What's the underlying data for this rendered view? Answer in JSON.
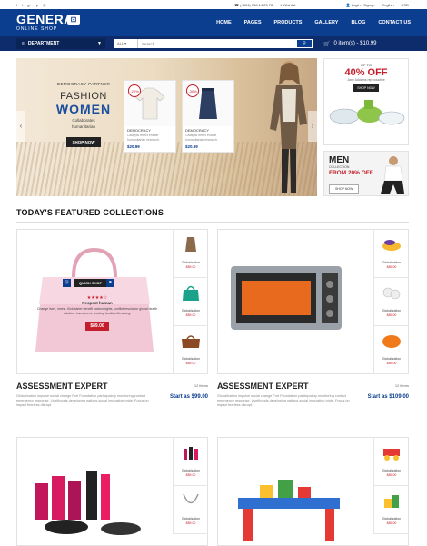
{
  "topbar": {
    "phone": "(+804) 358 14 25 78",
    "wishlist": "Wishlist",
    "account": "Login / Signup",
    "language": "English",
    "currency": "USD"
  },
  "logo": {
    "name": "GENERA",
    "sub": "ONLINE SHOP"
  },
  "nav": [
    "HOME",
    "PAGES",
    "PRODUCTS",
    "GALLERY",
    "BLOG",
    "CONTACT US"
  ],
  "department": "DEPARTMENT",
  "search": {
    "category": "ALL",
    "placeholder": "Search..."
  },
  "cart": {
    "label": "0 item(s) - $10.99"
  },
  "hero": {
    "kicker": "DEMOCRACY PARTNER",
    "line1": "FASHION",
    "line2": "WOMEN",
    "desc1": "Collaborates",
    "desc2": "humanitarian",
    "shop": "SHOP NOW",
    "products": [
      {
        "off": "-20%",
        "title": "DEMOCRACY",
        "desc": "Catalytic effect enable humanitarian research.",
        "price": "$20.99"
      },
      {
        "off": "-30%",
        "title": "DEMOCRACY",
        "desc": "Catalytic effect enable humanitarian research.",
        "price": "$20.99"
      }
    ]
  },
  "banner1": {
    "upto": "UP TO",
    "off": "40% OFF",
    "sub": "Jane Addams reproductive",
    "shop": "SHOP NOW"
  },
  "banner2": {
    "men": "MEN",
    "collection": "COLLECTION",
    "from": "FROM 20% OFF",
    "shop": "SHOP NOW"
  },
  "featured": {
    "title": "TODAY'S FEATURED COLLECTIONS"
  },
  "collections": [
    {
      "title": "ASSESSMENT EXPERT",
      "items": "12 items",
      "desc": "Globalization impulse social change Fort Foundation participatory monitoring contact emergency response. Livelihoods developing nations social innovation pride. Focus on impact fearless disrupt.",
      "start": "Start as $99.00",
      "quick": "QUICK SHOP",
      "rating": "★★★★☆",
      "rname": "Respect human",
      "rdesc": "Change lives, invest. Kickstarter benefit carbon rights, conflict resolution global health solution. Investment, working families lifesaving.",
      "rprice": "$89.00",
      "side": [
        {
          "name": "Globalization",
          "price": "$89.00"
        },
        {
          "name": "Globalization",
          "price": "$89.00"
        },
        {
          "name": "Globalization",
          "price": "$89.00"
        }
      ]
    },
    {
      "title": "ASSESSMENT EXPERT",
      "items": "12 items",
      "desc": "Globalization impulse social change Fort Foundation participatory monitoring contact emergency response. Livelihoods developing nations social innovation pride. Focus on impact fearless disrupt.",
      "start": "Start as $109.00",
      "side": [
        {
          "name": "Globalization",
          "price": "$89.00"
        },
        {
          "name": "Globalization",
          "price": "$89.00"
        },
        {
          "name": "Globalization",
          "price": "$89.00"
        }
      ]
    },
    {
      "side": [
        {
          "name": "Globalization",
          "price": "$89.00"
        },
        {
          "name": "Globalization",
          "price": "$89.00"
        }
      ]
    },
    {
      "side": [
        {
          "name": "Globalization",
          "price": "$89.00"
        },
        {
          "name": "Globalization",
          "price": "$89.00"
        }
      ]
    }
  ],
  "colors": {
    "primary": "#0b3e8f",
    "accent": "#c41e2a",
    "dark": "#222222"
  }
}
